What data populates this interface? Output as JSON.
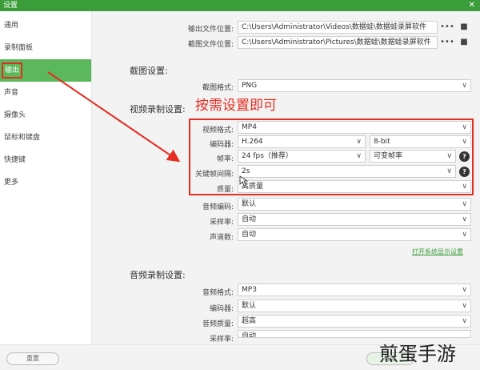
{
  "window": {
    "title": "设置",
    "close_glyph": "✕"
  },
  "sidebar": {
    "items": [
      {
        "label": "通用"
      },
      {
        "label": "录制面板"
      },
      {
        "label": "输出"
      },
      {
        "label": "声音"
      },
      {
        "label": "摄像头"
      },
      {
        "label": "鼠标和键盘"
      },
      {
        "label": "快捷键"
      },
      {
        "label": "更多"
      }
    ]
  },
  "paths": {
    "output_label": "输出文件位置:",
    "output_value": "C:\\Users\\Administrator\\Videos\\数据蛙\\数据蛙录屏软件",
    "screenshot_label": "截图文件位置:",
    "screenshot_value": "C:\\Users\\Administrator\\Pictures\\数据蛙\\数据蛙录屏软件",
    "more_glyph": "•••",
    "folder_glyph": "■"
  },
  "screenshot_settings": {
    "section_title": "截图设置:",
    "format_label": "截图格式:",
    "format_value": "PNG"
  },
  "video_settings": {
    "section_title": "视频录制设置:",
    "format_label": "视频格式:",
    "format_value": "MP4",
    "encoder_label": "编码器:",
    "encoder_value": "H.264",
    "bit_value": "8-bit",
    "framerate_label": "帧率:",
    "framerate_value": "24 fps（推荐）",
    "framerate_mode": "可变帧率",
    "keyframe_label": "关键帧间隔:",
    "keyframe_value": "2s",
    "quality_label": "质量:",
    "quality_value": "高质量",
    "audio_codec_label": "音频编码:",
    "audio_codec_value": "默认",
    "samplerate_label": "采样率:",
    "samplerate_value": "自动",
    "channels_label": "声道数:",
    "channels_value": "自动",
    "open_system_link": "打开系统显示设置"
  },
  "audio_settings": {
    "section_title": "音频录制设置:",
    "format_label": "音频格式:",
    "format_value": "MP3",
    "encoder_label": "编码器:",
    "encoder_value": "默认",
    "quality_label": "音频质量:",
    "quality_value": "超高",
    "samplerate_label": "采样率:",
    "samplerate_value": "自动"
  },
  "annotation": {
    "text": "按需设置即可",
    "color": "#e52d20"
  },
  "footer": {
    "reset_label": "重置",
    "confirm_label": "确定"
  },
  "watermark": {
    "text": "煎蛋手游"
  },
  "colors": {
    "accent": "#5cb85c",
    "highlight": "#e52d20"
  },
  "icons": {
    "chevron": "∨",
    "help": "?"
  }
}
